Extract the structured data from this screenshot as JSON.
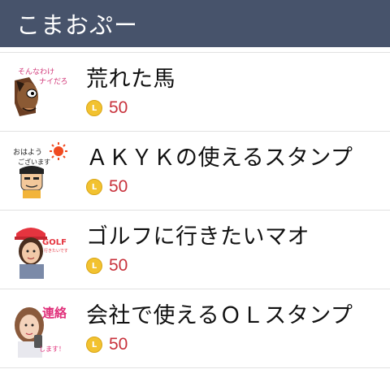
{
  "header": {
    "title": "こまおぷー"
  },
  "items": [
    {
      "name": "荒れた馬",
      "price": "50",
      "coin_letter": "L",
      "thumb_icon": "horse-sticker-icon",
      "thumb_text": [
        "そんなわけ",
        "ナイだろ"
      ]
    },
    {
      "name": "ＡＫＹＫの使えるスタンプ",
      "price": "50",
      "coin_letter": "L",
      "thumb_icon": "greeting-sticker-icon",
      "thumb_text": [
        "おはよう",
        "ございます"
      ]
    },
    {
      "name": "ゴルフに行きたいマオ",
      "price": "50",
      "coin_letter": "L",
      "thumb_icon": "golf-girl-sticker-icon",
      "thumb_text": [
        "GOLF",
        "行きたいです"
      ]
    },
    {
      "name": "会社で使えるＯＬスタンプ",
      "price": "50",
      "coin_letter": "L",
      "thumb_icon": "office-lady-sticker-icon",
      "thumb_text": [
        "連絡",
        "します！"
      ]
    }
  ],
  "colors": {
    "header_bg": "#47536b",
    "price": "#c8323c",
    "coin": "#f2c230"
  }
}
